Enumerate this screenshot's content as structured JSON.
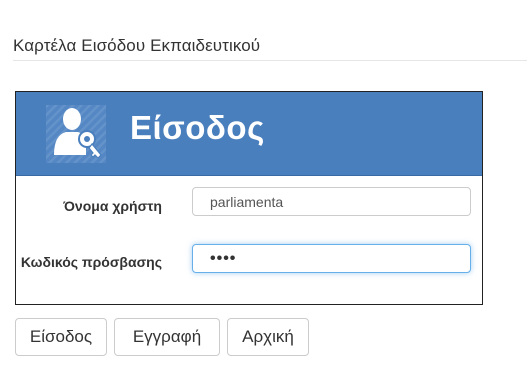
{
  "page": {
    "title": "Καρτέλα Εισόδου Εκπαιδευτικού"
  },
  "panel": {
    "heading": "Είσοδος",
    "icon": "user-key-icon",
    "header_color": "#4a7fbe"
  },
  "form": {
    "username_label": "Όνομα χρήστη",
    "username_value": "parliamenta",
    "password_label": "Κωδικός πρόσβασης",
    "password_value": "••••"
  },
  "buttons": {
    "login_label": "Είσοδος",
    "register_label": "Εγγραφή",
    "home_label": "Αρχική"
  },
  "colors": {
    "focus_border": "#66afe9"
  }
}
